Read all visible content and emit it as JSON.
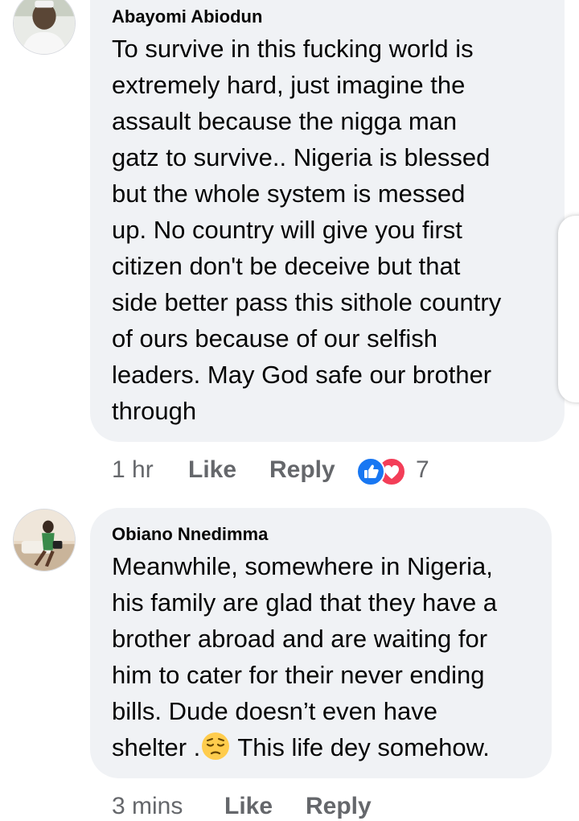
{
  "comments": [
    {
      "author": "Abayomi Abiodun",
      "avatar_icon": "person-avatar-icon",
      "lines": [
        "To survive in this fucking world is",
        "extremely hard, just imagine the",
        "assault because the nigga man",
        "gatz to survive.. Nigeria is blessed",
        "but the whole system is messed",
        "up. No country will give you first",
        "citizen don't be deceive but that",
        "side better pass this sithole country",
        "of ours because of our selfish",
        "leaders. May God safe our brother",
        "through"
      ],
      "time": "1 hr",
      "like_label": "Like",
      "reply_label": "Reply",
      "reactions": [
        "like-reaction-icon",
        "love-reaction-icon"
      ],
      "reaction_count": "7"
    },
    {
      "author": "Obiano Nnedimma",
      "avatar_icon": "person-avatar-icon",
      "lines": [
        "Meanwhile, somewhere in Nigeria,",
        "his family are glad that they have a",
        "brother abroad and are waiting for",
        "him to cater for their never ending",
        "bills. Dude doesn’t even have"
      ],
      "last_line_before_emoji": "shelter .",
      "last_line_emoji": "pensive-face-emoji",
      "last_line_after_emoji": " This life dey somehow.",
      "time": "3 mins",
      "like_label": "Like",
      "reply_label": "Reply"
    }
  ],
  "colors": {
    "bubble": "#f0f2f5",
    "meta_text": "#65676b",
    "like_blue": "#1877f2",
    "love_red": "#f33e58"
  }
}
